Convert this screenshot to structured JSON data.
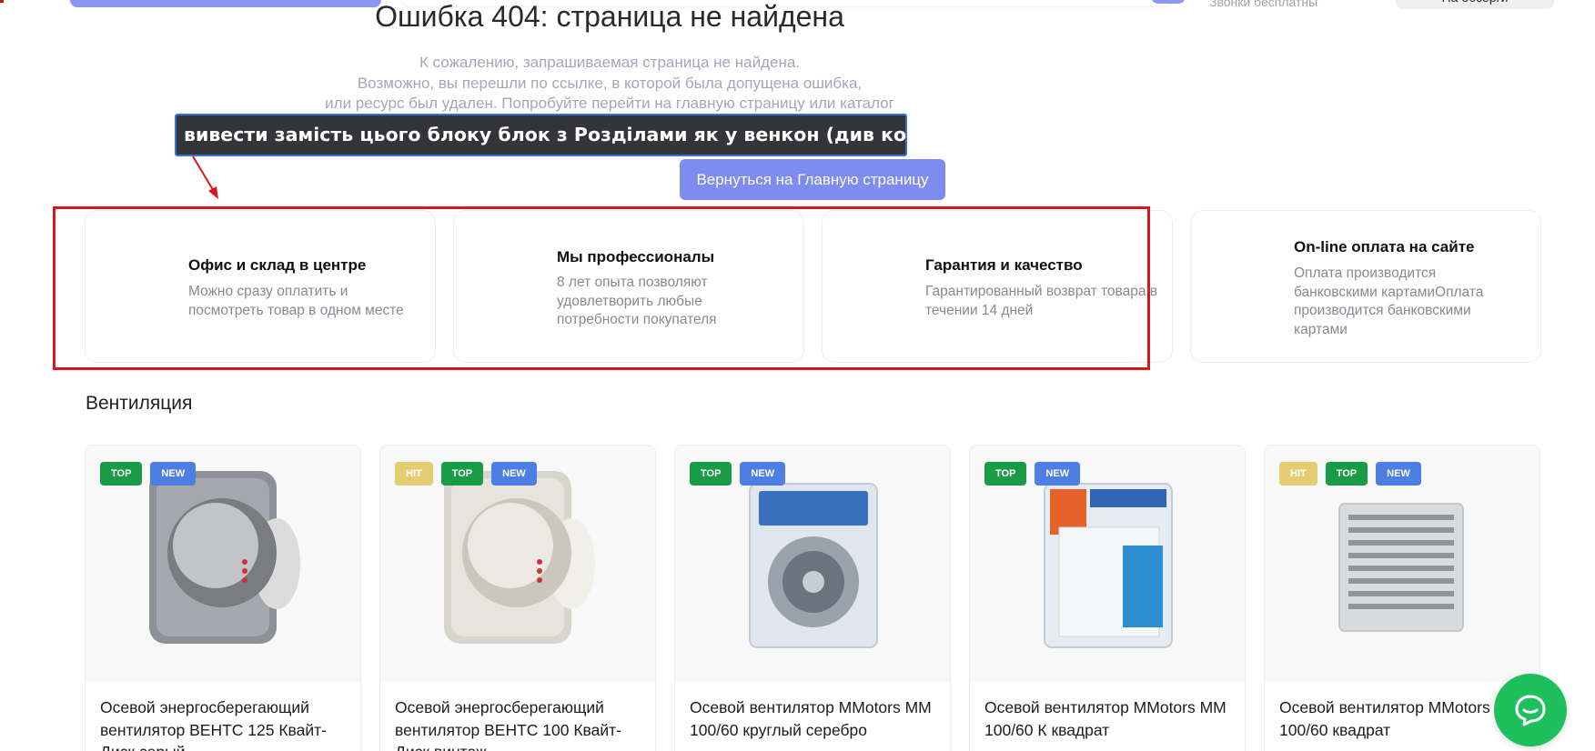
{
  "header": {
    "contact_note": "Звонки бесплатны",
    "right_button_label": "На обсерги"
  },
  "error": {
    "title": "Ошибка 404: страница не найдена",
    "lines": [
      "К сожалению, запрашиваемая страница не найдена.",
      "Возможно, вы перешли по ссылке, в которой была допущена ошибка,",
      "или ресурс был удален. Попробуйте перейти на главную страницу или каталог"
    ],
    "home_button_label": "Вернуться на Главную страницу"
  },
  "annotation": {
    "text": "вивести замість цього блоку блок з Розділами як у венкон (див комент)",
    "frame_color": "#d8161b"
  },
  "features": [
    {
      "title": "Офис и склад в центре",
      "desc": "Можно сразу оплатить и посмотреть товар в одном месте"
    },
    {
      "title": "Мы профессионалы",
      "desc": "8 лет опыта позволяют удовлетворить любые потребности покупателя"
    },
    {
      "title": "Гарантия и качество",
      "desc": "Гарантированный возврат товара в течении 14 дней"
    },
    {
      "title": "On-line оплата на сайте",
      "desc": "Оплата производится банковскими картамиОплата производится банковскими картами"
    }
  ],
  "section": {
    "title": "Вентиляция"
  },
  "products": [
    {
      "name": "Осевой энергосберегающий вентилятор ВЕНТС 125 Квайт-Диск серый",
      "badges": [
        "TOP",
        "NEW"
      ]
    },
    {
      "name": "Осевой энергосберегающий вентилятор ВЕНТС 100 Квайт-Диск винтаж",
      "badges": [
        "HIT",
        "TOP",
        "NEW"
      ]
    },
    {
      "name": "Осевой вентилятор MMotors ММ 100/60 круглый серебро",
      "badges": [
        "TOP",
        "NEW"
      ]
    },
    {
      "name": "Осевой вентилятор MMotors ММ 100/60 К квадрат",
      "badges": [
        "TOP",
        "NEW"
      ]
    },
    {
      "name": "Осевой вентилятор MMotors ММ 100/60 квадрат",
      "badges": [
        "HIT",
        "TOP",
        "NEW"
      ]
    }
  ],
  "colors": {
    "accent": "#7d8cee",
    "hit": "#e3cc72",
    "top": "#1a9b47",
    "new": "#4c7ee3",
    "chat": "#1ec05e"
  },
  "icons": {
    "chat": "chat-bubble-icon"
  }
}
